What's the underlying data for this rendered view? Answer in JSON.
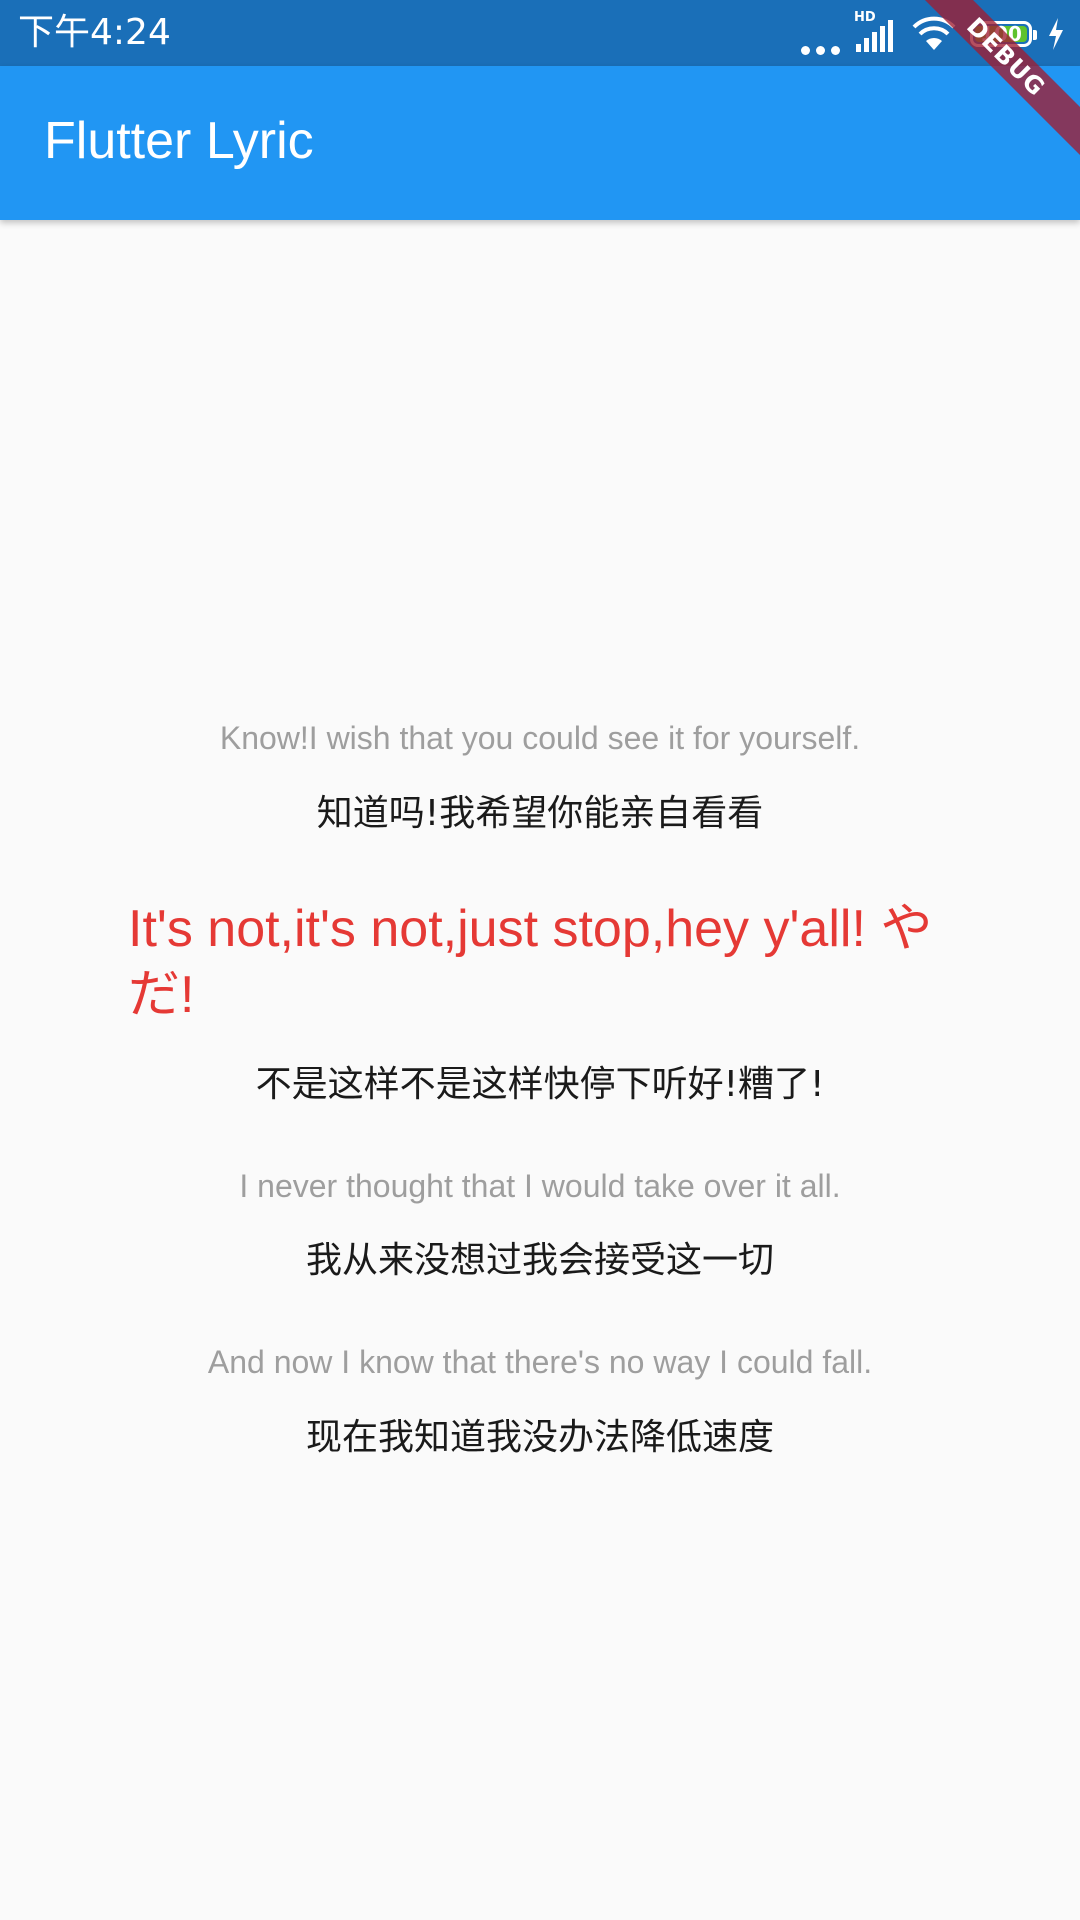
{
  "status_bar": {
    "time": "下午4:24",
    "network": "HD",
    "battery": "100",
    "icons": [
      "dots-icon",
      "signal-icon",
      "wifi-icon",
      "battery-icon",
      "charging-icon"
    ]
  },
  "app_bar": {
    "title": "Flutter Lyric",
    "debug_banner": "DEBUG",
    "background": "#2196f3"
  },
  "lyrics": {
    "lines": [
      {
        "text": "Know!I wish that you could see it for yourself.",
        "style": "secondary"
      },
      {
        "text": "知道吗!我希望你能亲自看看",
        "style": "translation"
      },
      {
        "text": "It's not,it's not,just stop,hey y'all! やだ!",
        "style": "current"
      },
      {
        "text": "不是这样不是这样快停下听好!糟了!",
        "style": "translation"
      },
      {
        "text": "I never thought that I would take over it all.",
        "style": "secondary"
      },
      {
        "text": "我从来没想过我会接受这一切",
        "style": "translation"
      },
      {
        "text": "And now I know that there's no way I could fall.",
        "style": "secondary"
      },
      {
        "text": "现在我知道我没办法降低速度",
        "style": "translation"
      }
    ],
    "colors": {
      "current": "#e53935",
      "secondary": "#9e9e9e",
      "translation": "#1a1a1a"
    }
  }
}
